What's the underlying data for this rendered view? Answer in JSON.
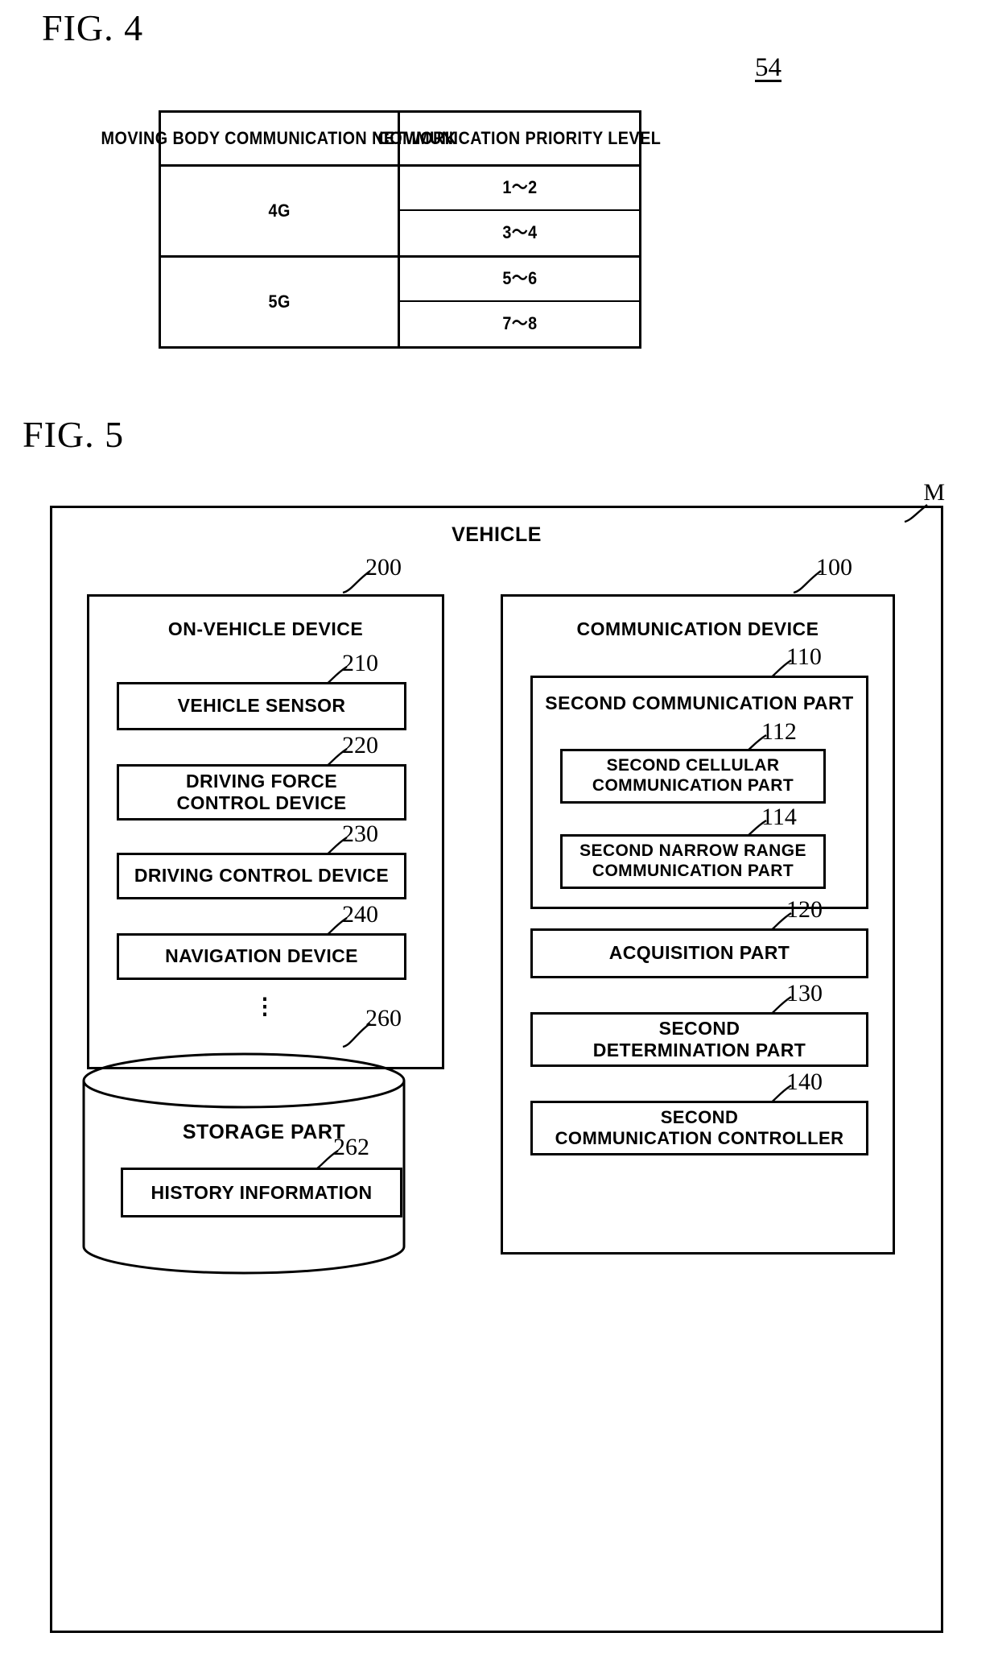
{
  "figures": {
    "fig4": {
      "caption": "FIG. 4",
      "reference": "54",
      "table": {
        "headers": [
          "MOVING BODY\nCOMMUNICATION NETWORK",
          "COMMUNICATION\nPRIORITY LEVEL"
        ],
        "groups": [
          {
            "network": "4G",
            "levels": [
              "1〜2",
              "3〜4"
            ]
          },
          {
            "network": "5G",
            "levels": [
              "5〜6",
              "7〜8"
            ]
          }
        ]
      }
    },
    "fig5": {
      "caption": "FIG. 5",
      "system_label": "M",
      "outer_title": "VEHICLE",
      "on_vehicle": {
        "ref": "200",
        "title": "ON-VEHICLE DEVICE",
        "items": [
          {
            "ref": "210",
            "label": "VEHICLE SENSOR"
          },
          {
            "ref": "220",
            "label": "DRIVING FORCE\nCONTROL DEVICE"
          },
          {
            "ref": "230",
            "label": "DRIVING CONTROL DEVICE"
          },
          {
            "ref": "240",
            "label": "NAVIGATION DEVICE"
          }
        ],
        "ellipsis": "⋮"
      },
      "storage": {
        "ref": "260",
        "title": "STORAGE PART",
        "inner": {
          "ref": "262",
          "label": "HISTORY INFORMATION"
        }
      },
      "communication_device": {
        "ref": "100",
        "title": "COMMUNICATION DEVICE",
        "second_communication_part": {
          "ref": "110",
          "title": "SECOND COMMUNICATION PART",
          "items": [
            {
              "ref": "112",
              "label": "SECOND CELLULAR\nCOMMUNICATION PART"
            },
            {
              "ref": "114",
              "label": "SECOND NARROW RANGE\nCOMMUNICATION PART"
            }
          ]
        },
        "items": [
          {
            "ref": "120",
            "label": "ACQUISITION PART"
          },
          {
            "ref": "130",
            "label": "SECOND\nDETERMINATION PART"
          },
          {
            "ref": "140",
            "label": "SECOND\nCOMMUNICATION CONTROLLER"
          }
        ]
      }
    }
  }
}
